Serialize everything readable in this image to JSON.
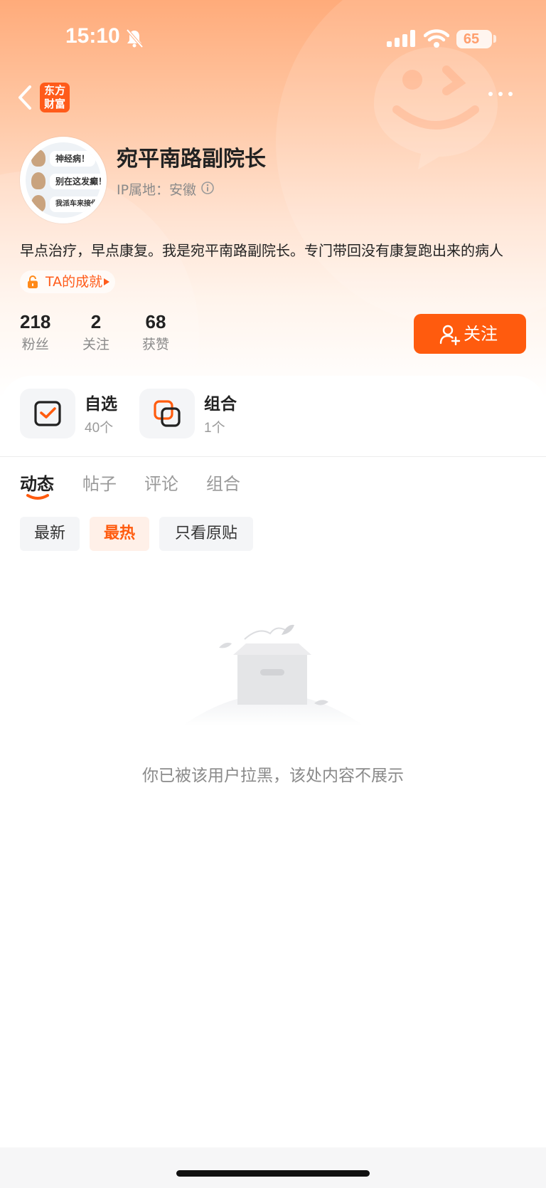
{
  "status_bar": {
    "time": "15:10",
    "battery": "65"
  },
  "nav": {
    "logo_line1": "东方",
    "logo_line2": "财富"
  },
  "avatar": {
    "bubbles": [
      "神经病！",
      "别在这发癫！",
      "我派车来接你！"
    ]
  },
  "profile": {
    "name": "宛平南路副院长",
    "ip_location": "IP属地：安徽",
    "bio": "早点治疗，早点康复。我是宛平南路副院长。专门带回没有康复跑出来的病人",
    "achievement": "TA的成就"
  },
  "stats": [
    {
      "value": "218",
      "label": "粉丝"
    },
    {
      "value": "2",
      "label": "关注"
    },
    {
      "value": "68",
      "label": "获赞"
    }
  ],
  "follow_button": "关注",
  "tools": [
    {
      "title": "自选",
      "count": "40个"
    },
    {
      "title": "组合",
      "count": "1个"
    }
  ],
  "tabs": [
    "动态",
    "帖子",
    "评论",
    "组合"
  ],
  "filters": [
    "最新",
    "最热",
    "只看原贴"
  ],
  "empty_message": "你已被该用户拉黑，该处内容不展示",
  "colors": {
    "accent": "#ff5b0e",
    "header_top": "#ffab7a"
  }
}
